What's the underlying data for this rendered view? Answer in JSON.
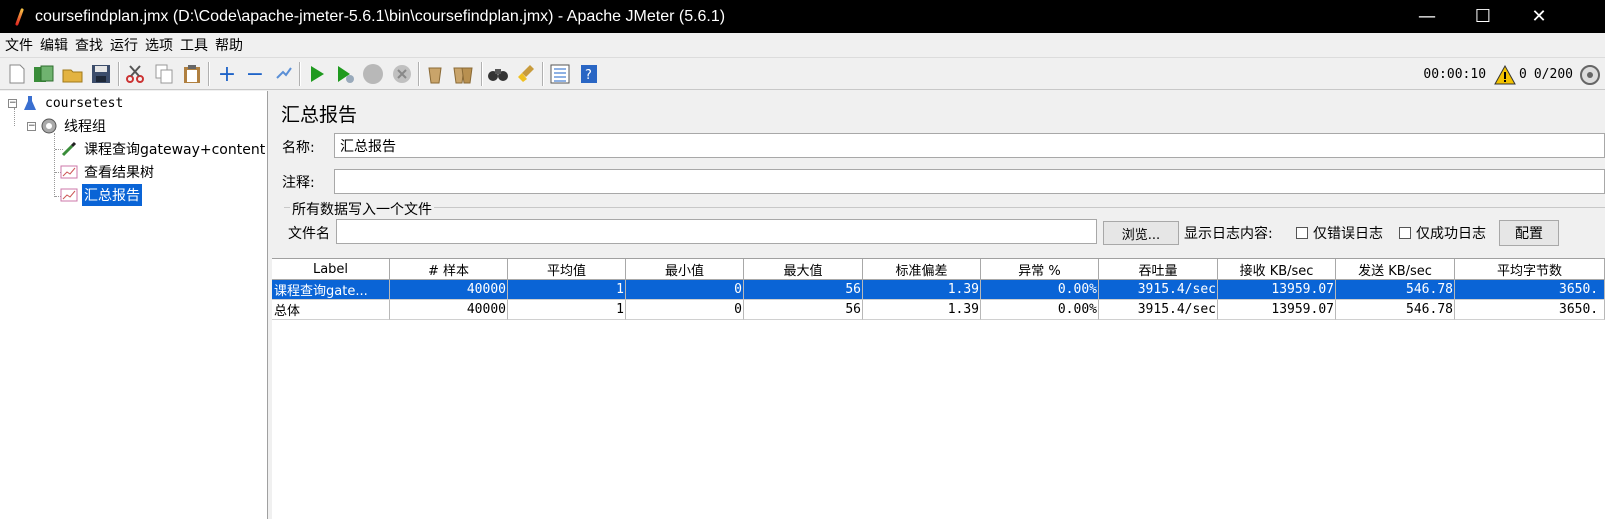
{
  "window": {
    "title": "coursefindplan.jmx (D:\\Code\\apache-jmeter-5.6.1\\bin\\coursefindplan.jmx) - Apache JMeter (5.6.1)",
    "minimize": "—",
    "maximize": "☐",
    "close": "✕"
  },
  "menu": [
    "文件",
    "编辑",
    "查找",
    "运行",
    "选项",
    "工具",
    "帮助"
  ],
  "toolbar": {
    "timer": "00:00:10",
    "warn_count": "0",
    "threads": "0/200"
  },
  "tree": {
    "root": "coursetest",
    "thread_group": "线程组",
    "sampler": "课程查询gateway+content",
    "listener1": "查看结果树",
    "listener2": "汇总报告"
  },
  "panel": {
    "title": "汇总报告",
    "name_label": "名称:",
    "name_value": "汇总报告",
    "comment_label": "注释:",
    "comment_value": "",
    "group_title": "所有数据写入一个文件",
    "file_label": "文件名",
    "file_value": "",
    "browse_label": "浏览...",
    "log_label": "显示日志内容:",
    "errors_only": "仅错误日志",
    "success_only": "仅成功日志",
    "config_label": "配置"
  },
  "table": {
    "columns": [
      "Label",
      "# 样本",
      "平均值",
      "最小值",
      "最大值",
      "标准偏差",
      "异常 %",
      "吞吐量",
      "接收 KB/sec",
      "发送 KB/sec",
      "平均字节数"
    ],
    "rows": [
      [
        "课程查询gate...",
        "40000",
        "1",
        "0",
        "56",
        "1.39",
        "0.00%",
        "3915.4/sec",
        "13959.07",
        "546.78",
        "3650."
      ],
      [
        "总体",
        "40000",
        "1",
        "0",
        "56",
        "1.39",
        "0.00%",
        "3915.4/sec",
        "13959.07",
        "546.78",
        "3650."
      ]
    ]
  }
}
